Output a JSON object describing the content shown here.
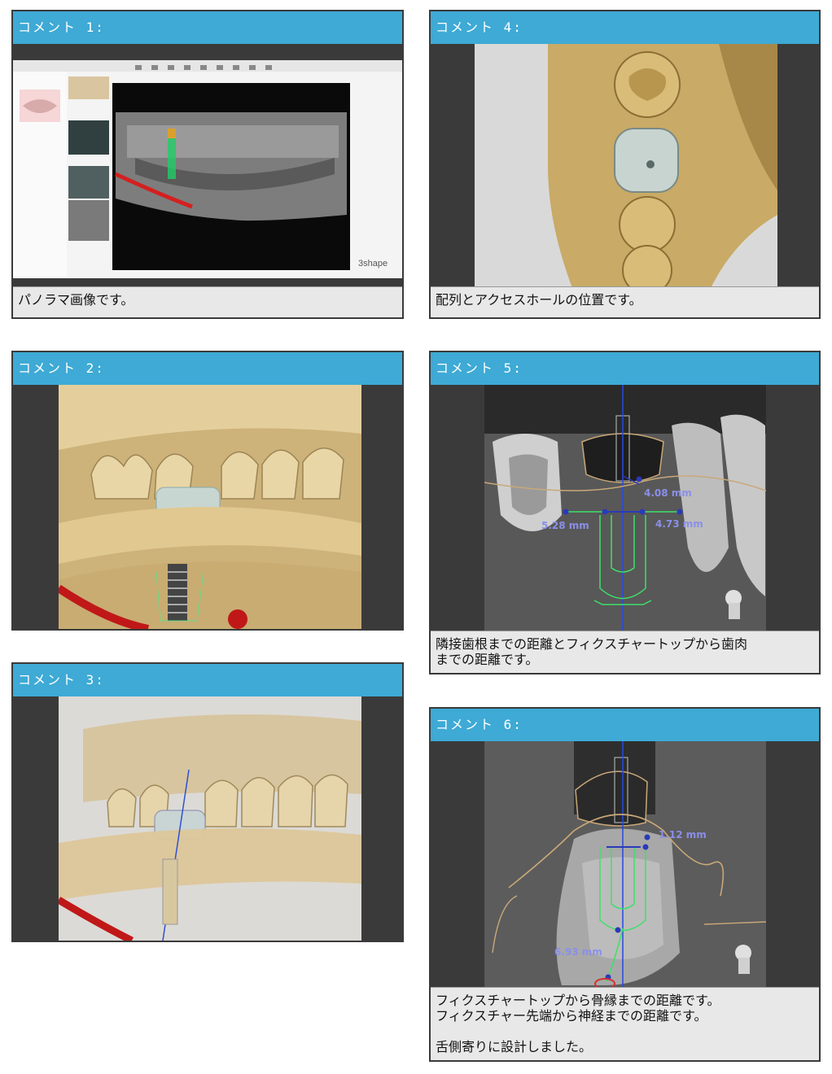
{
  "panels": [
    {
      "title": "コメント 1:",
      "caption": "パノラマ画像です。"
    },
    {
      "title": "コメント 2:",
      "caption": ""
    },
    {
      "title": "コメント 3:",
      "caption": ""
    },
    {
      "title": "コメント 4:",
      "caption": "配列とアクセスホールの位置です。"
    },
    {
      "title": "コメント 5:",
      "caption": "隣接歯根までの距離とフィクスチャートップから歯肉\nまでの距離です。"
    },
    {
      "title": "コメント 6:",
      "caption": "フィクスチャートップから骨縁までの距離です。\nフィクスチャー先端から神経までの距離です。\n\n舌側寄りに設計しました。"
    }
  ],
  "panel1": {
    "brand": "3shape"
  },
  "panel5": {
    "measure_top": "4.08 mm",
    "measure_left": "5.28 mm",
    "measure_right": "4.73 mm"
  },
  "panel6": {
    "measure_top": "1.12 mm",
    "measure_bottom": "6.93 mm"
  }
}
